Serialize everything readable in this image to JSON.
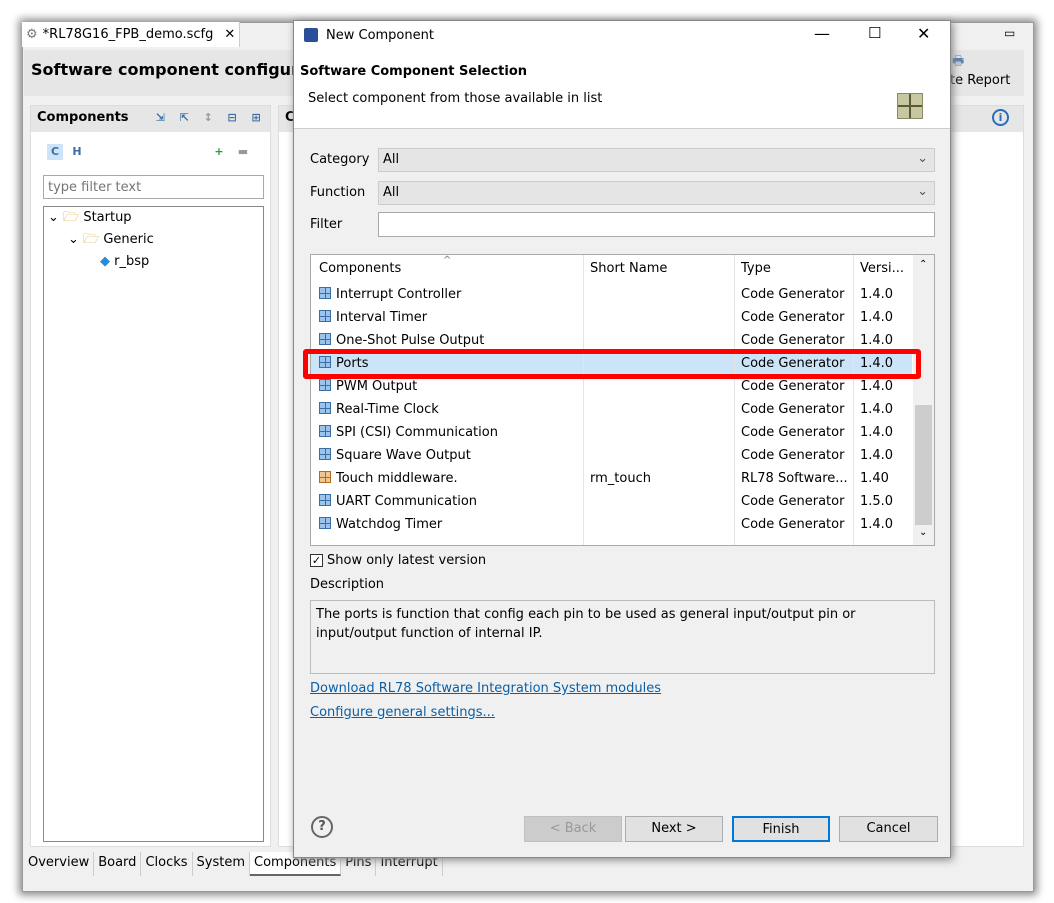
{
  "editor": {
    "tab_title": "*RL78G16_FPB_demo.scfg",
    "header_title": "Software component configurat",
    "generate_report_label": "te Report",
    "components_panel": {
      "title": "Components",
      "filter_placeholder": "type filter text",
      "tree": [
        {
          "label": "Startup",
          "icon": "folder-open-icon"
        },
        {
          "label": "Generic",
          "icon": "folder-open-icon"
        },
        {
          "label": "r_bsp",
          "icon": "component-cube-icon"
        }
      ]
    },
    "right_panel_title": "C",
    "bottom_tabs": [
      "Overview",
      "Board",
      "Clocks",
      "System",
      "Components",
      "Pins",
      "Interrupt"
    ],
    "active_bottom_tab": "Components"
  },
  "dialog": {
    "title": "New Component",
    "heading": "Software Component Selection",
    "subheading": "Select component from those available in list",
    "category_label": "Category",
    "category_value": "All",
    "function_label": "Function",
    "function_value": "All",
    "filter_label": "Filter",
    "filter_value": "",
    "columns": [
      "Components",
      "Short Name",
      "Type",
      "Versi..."
    ],
    "rows": [
      {
        "name": "Interrupt Controller",
        "short": "",
        "type": "Code Generator",
        "version": "1.4.0",
        "icon": "blue"
      },
      {
        "name": "Interval Timer",
        "short": "",
        "type": "Code Generator",
        "version": "1.4.0",
        "icon": "blue"
      },
      {
        "name": "One-Shot Pulse Output",
        "short": "",
        "type": "Code Generator",
        "version": "1.4.0",
        "icon": "blue"
      },
      {
        "name": "Ports",
        "short": "",
        "type": "Code Generator",
        "version": "1.4.0",
        "icon": "blue",
        "selected": true
      },
      {
        "name": "PWM Output",
        "short": "",
        "type": "Code Generator",
        "version": "1.4.0",
        "icon": "blue"
      },
      {
        "name": "Real-Time Clock",
        "short": "",
        "type": "Code Generator",
        "version": "1.4.0",
        "icon": "blue"
      },
      {
        "name": "SPI (CSI) Communication",
        "short": "",
        "type": "Code Generator",
        "version": "1.4.0",
        "icon": "blue"
      },
      {
        "name": "Square Wave Output",
        "short": "",
        "type": "Code Generator",
        "version": "1.4.0",
        "icon": "blue"
      },
      {
        "name": "Touch middleware.",
        "short": "rm_touch",
        "type": "RL78 Software...",
        "version": "1.40",
        "icon": "orange"
      },
      {
        "name": "UART Communication",
        "short": "",
        "type": "Code Generator",
        "version": "1.5.0",
        "icon": "blue"
      },
      {
        "name": "Watchdog Timer",
        "short": "",
        "type": "Code Generator",
        "version": "1.4.0",
        "icon": "blue"
      }
    ],
    "show_latest_label": "Show only latest version",
    "show_latest_checked": true,
    "description_label": "Description",
    "description_text": "The ports is function that config each pin to be used as general input/output pin or input/output function of internal IP.",
    "link_download": "Download RL78 Software Integration System modules",
    "link_configure": "Configure general settings...",
    "buttons": {
      "back": "< Back",
      "next": "Next >",
      "finish": "Finish",
      "cancel": "Cancel"
    },
    "highlight_color": "#ff0000",
    "selection_color": "#cce4f7"
  }
}
